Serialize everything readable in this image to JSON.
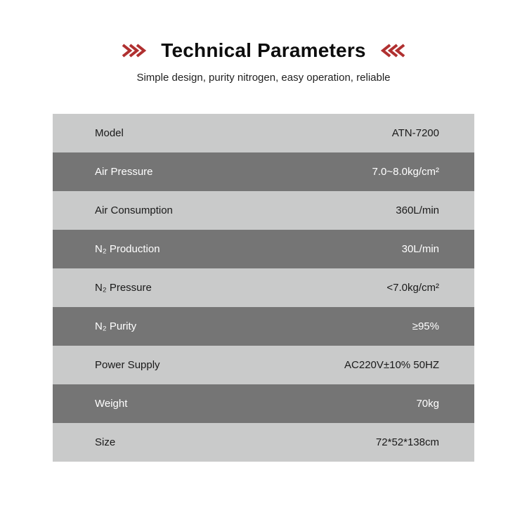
{
  "header": {
    "title": "Technical Parameters",
    "subtitle": "Simple design, purity nitrogen, easy operation, reliable",
    "left_icon": "triple-chevron-right-icon",
    "right_icon": "triple-chevron-left-icon",
    "accent_color": "#b03030",
    "title_color": "#0d0d0d"
  },
  "table": {
    "row_light_color": "#c9caca",
    "row_dark_color": "#757575",
    "rows": [
      {
        "label": "Model",
        "value": "ATN-7200",
        "style": "light"
      },
      {
        "label": "Air Pressure",
        "value": "7.0~8.0kg/cm²",
        "style": "dark"
      },
      {
        "label": "Air Consumption",
        "value": "360L/min",
        "style": "light"
      },
      {
        "label": "N₂ Production",
        "value": "30L/min",
        "style": "dark"
      },
      {
        "label": "N₂ Pressure",
        "value": "<7.0kg/cm²",
        "style": "light"
      },
      {
        "label": "N₂ Purity",
        "value": "≥95%",
        "style": "dark"
      },
      {
        "label": "Power Supply",
        "value": "AC220V±10% 50HZ",
        "style": "light"
      },
      {
        "label": "Weight",
        "value": "70kg",
        "style": "dark"
      },
      {
        "label": "Size",
        "value": "72*52*138cm",
        "style": "light"
      }
    ]
  }
}
